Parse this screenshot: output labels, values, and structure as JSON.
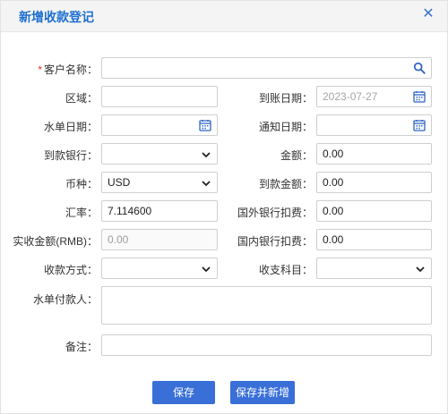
{
  "dialog": {
    "title": "新增收款登记",
    "close_icon": "close-icon"
  },
  "form": {
    "customer_name": {
      "label": "客户名称：",
      "required_mark": "*",
      "value": "",
      "icon": "search-icon"
    },
    "region": {
      "label": "区域：",
      "value": ""
    },
    "arrival_date": {
      "label": "到账日期：",
      "value": "2023-07-27",
      "icon": "calendar-icon"
    },
    "waterbill_date": {
      "label": "水单日期：",
      "value": "",
      "icon": "calendar-icon"
    },
    "notice_date": {
      "label": "通知日期：",
      "value": "",
      "icon": "calendar-icon"
    },
    "arrival_bank": {
      "label": "到款银行：",
      "value": ""
    },
    "amount": {
      "label": "金额：",
      "value": "0.00"
    },
    "currency": {
      "label": "币种：",
      "value": "USD"
    },
    "arrival_amount": {
      "label": "到款金额：",
      "value": "0.00"
    },
    "exchange_rate": {
      "label": "汇率：",
      "value": "7.114600"
    },
    "foreign_bank_fee": {
      "label": "国外银行扣费：",
      "value": "0.00"
    },
    "actual_rmb": {
      "label": "实收金额(RMB)：",
      "value": "0.00"
    },
    "domestic_bank_fee": {
      "label": "国内银行扣费：",
      "value": "0.00"
    },
    "payment_method": {
      "label": "收款方式：",
      "value": ""
    },
    "account_subject": {
      "label": "收支科目：",
      "value": ""
    },
    "waterbill_payer": {
      "label": "水单付款人：",
      "value": ""
    },
    "remarks": {
      "label": "备注：",
      "value": ""
    }
  },
  "buttons": {
    "save": "保存",
    "save_and_new": "保存并新增"
  },
  "colors": {
    "title": "#1f6fd1",
    "button": "#3a6fd8",
    "required": "#d33333"
  }
}
